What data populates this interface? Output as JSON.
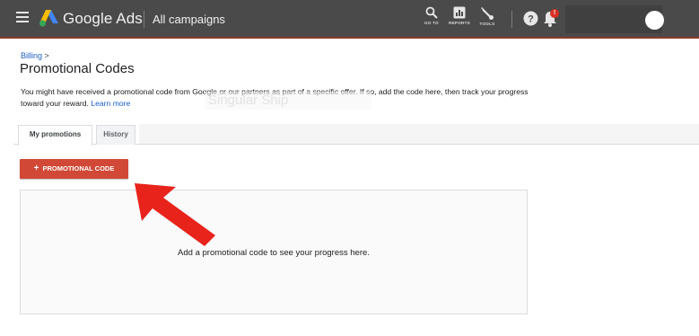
{
  "app": {
    "product_name": "Google Ads",
    "section": "All campaigns"
  },
  "toolbar": {
    "goto_label": "GO TO",
    "reports_label": "REPORTS",
    "tools_label": "TOOLS",
    "notification_count": "!",
    "accent_color": "#d93025"
  },
  "page": {
    "breadcrumb_link": "Billing",
    "breadcrumb_separator": ">",
    "title": "Promotional Codes",
    "description": "You might have received a promotional code from Google or our partners as part of a specific offer. If so, add the code here, then track your progress toward your reward.",
    "learn_more": "Learn more",
    "watermark": "Singular Ship"
  },
  "tabs": [
    {
      "label": "My promotions",
      "active": true
    },
    {
      "label": "History",
      "active": false
    }
  ],
  "actions": {
    "add_promo_label": "PROMOTIONAL CODE",
    "add_promo_color": "#d14836"
  },
  "empty_state": {
    "message": "Add a promotional code to see your progress here."
  },
  "icons": {
    "menu": "hamburger-icon",
    "logo": "google-ads-logo",
    "goto": "search-icon",
    "reports": "bar-chart-icon",
    "tools": "wrench-icon",
    "help": "help-icon",
    "notifications": "bell-icon",
    "account": "avatar",
    "annotation": "red-arrow"
  }
}
